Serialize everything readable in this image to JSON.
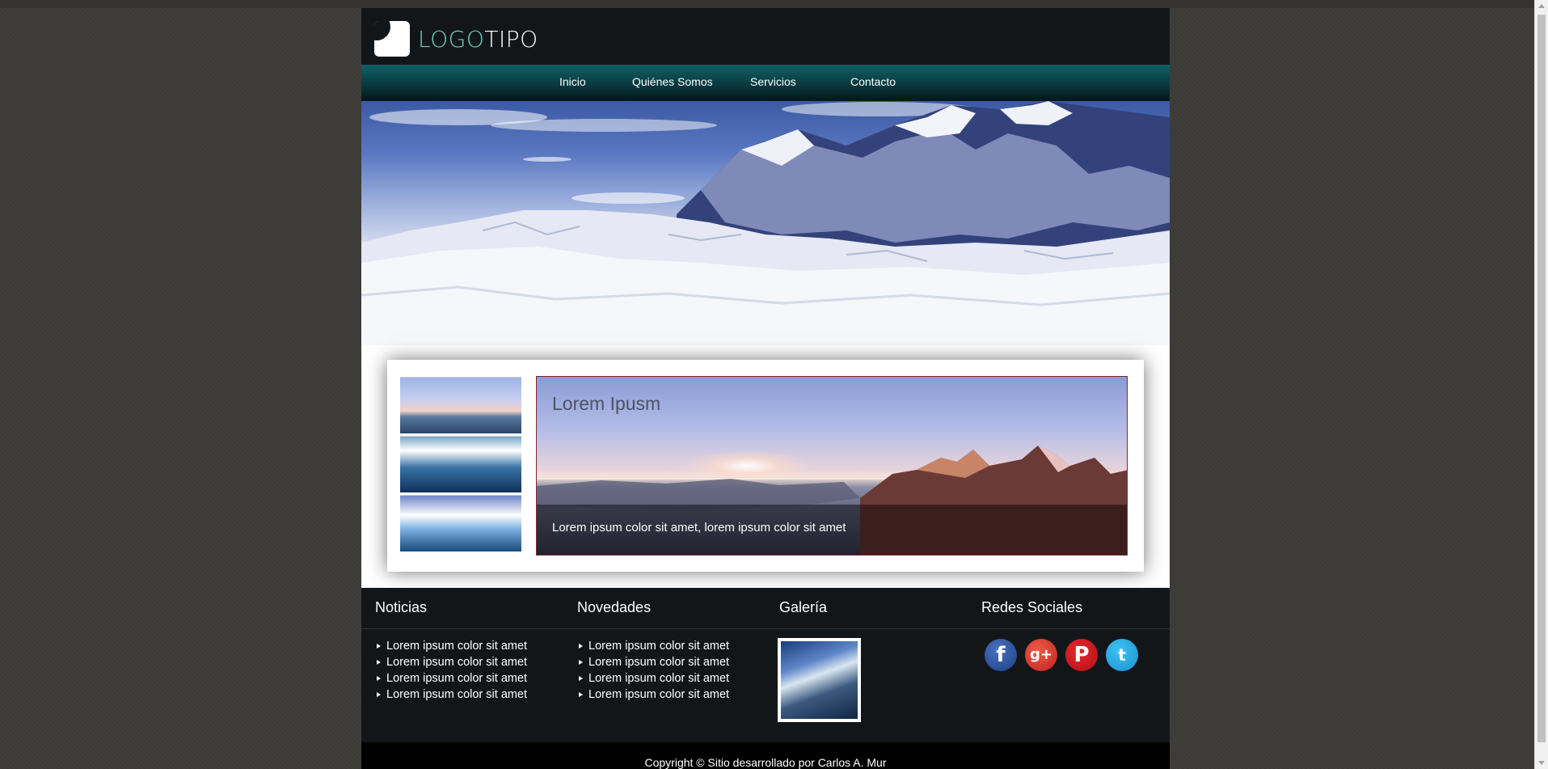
{
  "header": {
    "logo_part1": "LOGO",
    "logo_part2": "TIPO"
  },
  "nav": {
    "items": [
      {
        "label": "Inicio"
      },
      {
        "label": "Quiénes Somos"
      },
      {
        "label": "Servicios"
      },
      {
        "label": "Contacto"
      }
    ]
  },
  "slider": {
    "title": "Lorem Ipusm",
    "caption": "Lorem ipsum color sit amet, lorem ipsum color sit amet",
    "thumbnails": [
      "sunset-thumbnail",
      "ocean-mountain-thumbnail",
      "wave-thumbnail"
    ]
  },
  "footer": {
    "columns": [
      {
        "title": "Noticias",
        "items": [
          "Lorem ipsum color sit amet",
          "Lorem ipsum color sit amet",
          "Lorem ipsum color sit amet",
          "Lorem ipsum color sit amet"
        ]
      },
      {
        "title": "Novedades",
        "items": [
          "Lorem ipsum color sit amet",
          "Lorem ipsum color sit amet",
          "Lorem ipsum color sit amet",
          "Lorem ipsum color sit amet"
        ]
      },
      {
        "title": "Galería"
      },
      {
        "title": "Redes Sociales"
      }
    ],
    "social": [
      {
        "icon": "facebook-icon",
        "glyph": "f",
        "color": "#3b5998"
      },
      {
        "icon": "google-plus-icon",
        "glyph": "g+",
        "color": "#dd4b39"
      },
      {
        "icon": "pinterest-icon",
        "glyph": "P",
        "color": "#cb2027"
      },
      {
        "icon": "twitter-icon",
        "glyph": "t",
        "color": "#1da1f2"
      }
    ],
    "copyright": "Copyright © Sitio desarrollado por Carlos A. Mur"
  },
  "colors": {
    "background": "#3d3b38",
    "header": "#121619",
    "nav_accent": "#0e6166",
    "logo_accent": "#6fd0c4"
  }
}
